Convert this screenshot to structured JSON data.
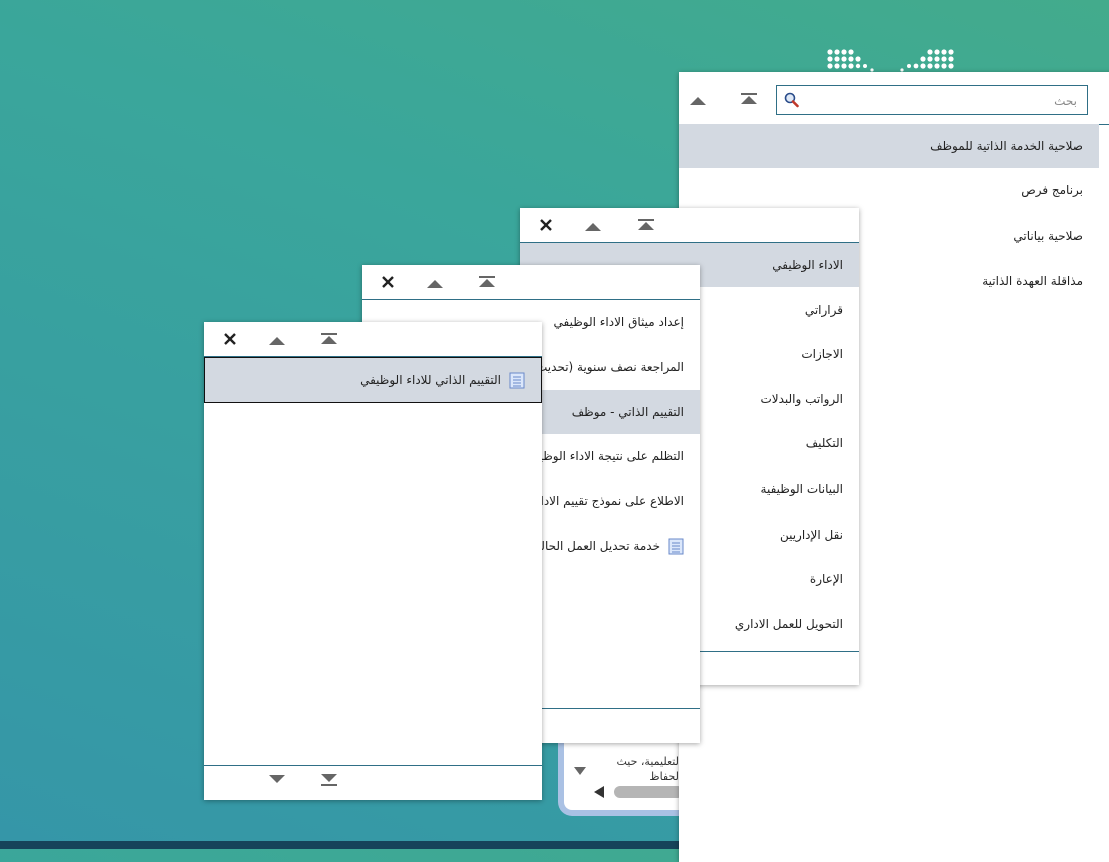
{
  "background": {
    "gradient_top": "#43ab8c",
    "gradient_bottom": "#3596a8",
    "strip_color": "#16435a"
  },
  "main_panel": {
    "search_placeholder": "بحث",
    "items": [
      {
        "label": "صلاحية الخدمة الذاتية للموظف",
        "selected": true
      },
      {
        "label": "برنامج فرص",
        "selected": false
      },
      {
        "label": "صلاحية بياناتي",
        "selected": false
      },
      {
        "label": "مذاقلة العهدة الذاتية",
        "selected": false
      }
    ]
  },
  "panel_level2": {
    "items": [
      {
        "label": "الاداء الوظيفي",
        "selected": true
      },
      {
        "label": "قراراتي",
        "selected": false
      },
      {
        "label": "الاجازات",
        "selected": false
      },
      {
        "label": "الرواتب والبدلات",
        "selected": false
      },
      {
        "label": "التكليف",
        "selected": false
      },
      {
        "label": "البيانات الوظيفية",
        "selected": false
      },
      {
        "label": "نقل الإداريين",
        "selected": false
      },
      {
        "label": "الإعارة",
        "selected": false
      },
      {
        "label": "التحويل للعمل الاداري",
        "selected": false
      }
    ]
  },
  "panel_level3": {
    "items": [
      {
        "label": "إعداد ميثاق الاداء الوظيفي",
        "selected": false,
        "icon": ""
      },
      {
        "label": "المراجعة نصف سنوية (تحديث م",
        "selected": false,
        "icon": ""
      },
      {
        "label": "التقييم الذاتي - موظف",
        "selected": true,
        "icon": ""
      },
      {
        "label": "التظلم على نتيجة الاداء الوظيفي",
        "selected": false,
        "icon": ""
      },
      {
        "label": "الاطلاع على نموذج تقييم الاداء ا",
        "selected": false,
        "icon": ""
      },
      {
        "label": "خدمة تحديل العمل الحالي ا",
        "selected": false,
        "icon": "document-icon"
      }
    ]
  },
  "panel_level4": {
    "items": [
      {
        "label": "التقييم الذاتي للاداء الوظيفي",
        "selected": true,
        "icon": "document-icon"
      }
    ]
  },
  "background_fragment": {
    "line1": "التعليمية، حيث",
    "line2": "الحفاظ"
  }
}
